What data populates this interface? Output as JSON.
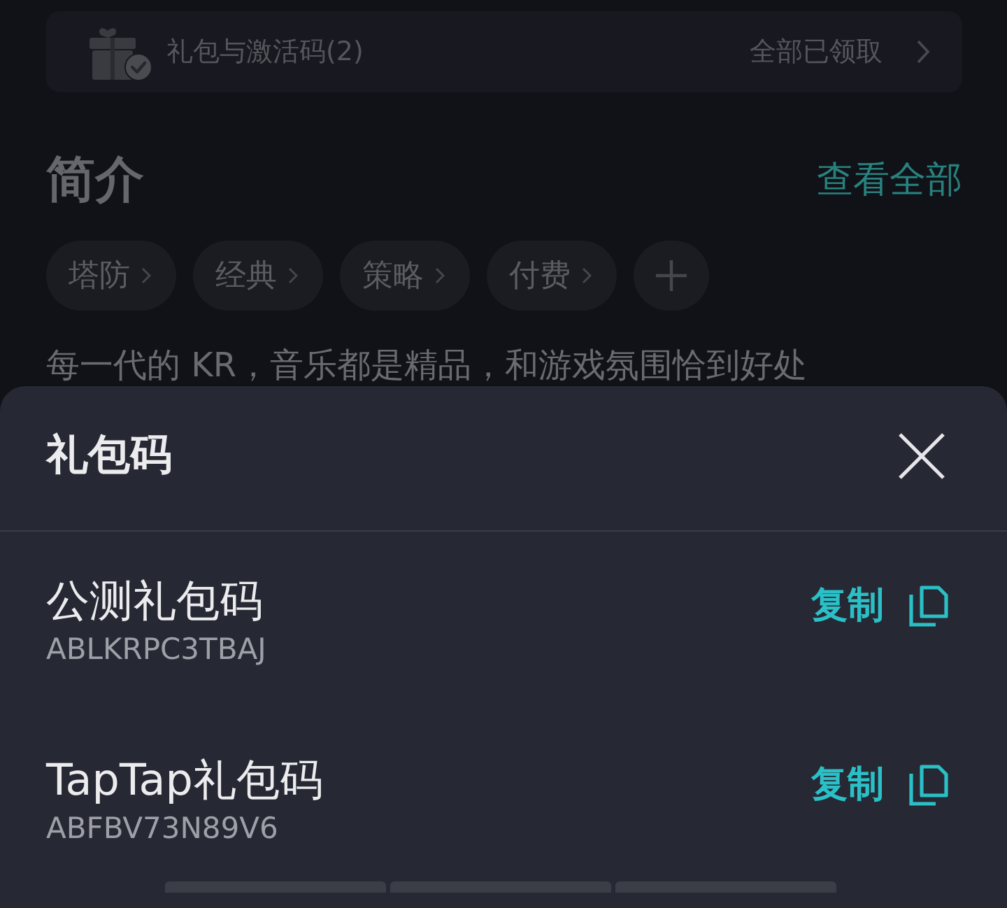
{
  "gift_card": {
    "title": "礼包与激活码(2)",
    "status": "全部已领取"
  },
  "intro": {
    "heading": "简介",
    "view_all": "查看全部",
    "tags": [
      {
        "label": "塔防"
      },
      {
        "label": "经典"
      },
      {
        "label": "策略"
      },
      {
        "label": "付费"
      }
    ],
    "description": "每一代的 KR，音乐都是精品，和游戏氛围恰到好处"
  },
  "sheet": {
    "title": "礼包码",
    "codes": [
      {
        "name": "公测礼包码",
        "code": "ABLKRPC3TBAJ",
        "action": "复制"
      },
      {
        "name": "TapTap礼包码",
        "code": "ABFBV73N89V6",
        "action": "复制"
      }
    ]
  }
}
